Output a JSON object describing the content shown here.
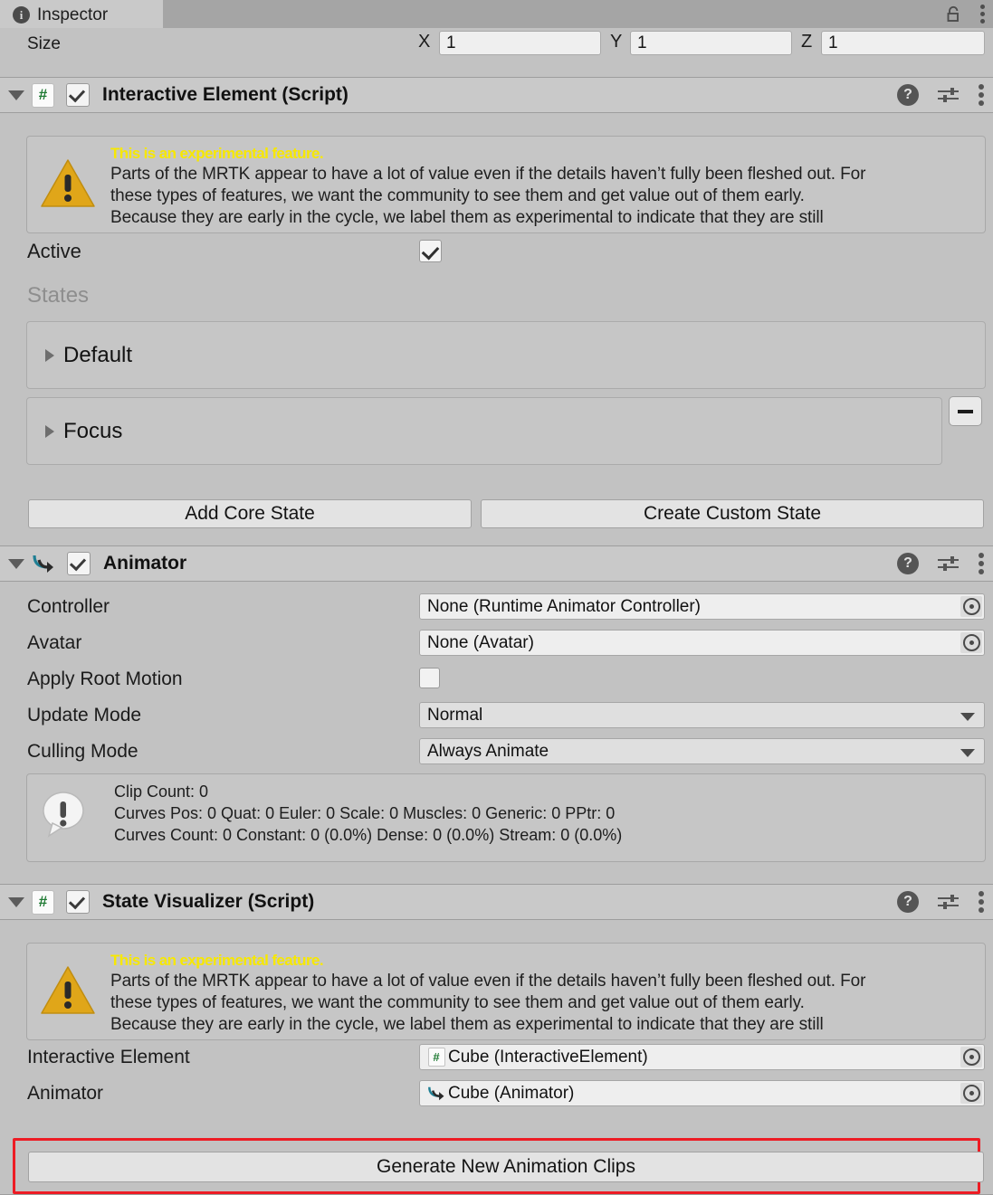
{
  "window": {
    "tab_label": "Inspector",
    "info_icon": "info-icon",
    "lock_icon": "lock-icon",
    "kebab_icon": "kebab-menu-icon"
  },
  "size_row": {
    "label": "Size",
    "x_axis": "X",
    "x_value": "1",
    "y_axis": "Y",
    "y_value": "1",
    "z_axis": "Z",
    "z_value": "1"
  },
  "components": [
    {
      "title": "Interactive Element (Script)",
      "icon": "script-icon",
      "icon_glyph": "#",
      "enabled": true,
      "help_icon": "help-icon",
      "preset_icon": "preset-icon",
      "kebab_icon": "kebab-menu-icon"
    },
    {
      "title": "Animator",
      "icon": "animator-icon",
      "enabled": true,
      "help_icon": "help-icon",
      "preset_icon": "preset-icon",
      "kebab_icon": "kebab-menu-icon"
    },
    {
      "title": "State Visualizer (Script)",
      "icon": "script-icon",
      "icon_glyph": "#",
      "enabled": true,
      "help_icon": "help-icon",
      "preset_icon": "preset-icon",
      "kebab_icon": "kebab-menu-icon"
    }
  ],
  "experimental_warning": {
    "icon": "warning-triangle-icon",
    "title": "This is an experimental feature.",
    "line1": "Parts of the MRTK appear to have a lot of value even if the details haven’t fully been fleshed out. For",
    "line2": "these types of features, we want the community to see them and get value out of them early.",
    "line3": "Because they are early in the cycle, we label them as experimental to indicate that they are still"
  },
  "interactive_element": {
    "active_label": "Active",
    "active_checked": true,
    "states_label": "States",
    "states": [
      {
        "name": "Default",
        "removable": false
      },
      {
        "name": "Focus",
        "removable": true,
        "remove_label": "–"
      }
    ],
    "add_core_state_button": "Add Core State",
    "create_custom_state_button": "Create Custom State"
  },
  "animator": {
    "fields": [
      {
        "label": "Controller",
        "value": "None (Runtime Animator Controller)",
        "type": "object"
      },
      {
        "label": "Avatar",
        "value": "None (Avatar)",
        "type": "object"
      },
      {
        "label": "Apply Root Motion",
        "value": "",
        "type": "checkbox",
        "checked": false
      },
      {
        "label": "Update Mode",
        "value": "Normal",
        "type": "dropdown"
      },
      {
        "label": "Culling Mode",
        "value": "Always Animate",
        "type": "dropdown"
      }
    ],
    "info": {
      "icon": "info-bubble-icon",
      "line1": "Clip Count: 0",
      "line2": "Curves Pos: 0 Quat: 0 Euler: 0 Scale: 0 Muscles: 0 Generic: 0 PPtr: 0",
      "line3": "Curves Count: 0 Constant: 0 (0.0%) Dense: 0 (0.0%) Stream: 0 (0.0%)"
    }
  },
  "state_visualizer": {
    "interactive_element_label": "Interactive Element",
    "interactive_element_value": "Cube (InteractiveElement)",
    "interactive_element_icon": "script-icon",
    "interactive_element_icon_glyph": "#",
    "animator_label": "Animator",
    "animator_value": "Cube (Animator)",
    "animator_icon": "animator-icon",
    "generate_button": "Generate New Animation Clips"
  },
  "colors": {
    "background": "#c2c2c2",
    "header": "#c9c9c9",
    "tabbar": "#a5a5a5",
    "warning_yellow": "#f7e800",
    "warning_triangle": "#e0a619",
    "script_green": "#1f7a33",
    "animator_teal": "#1f7f94",
    "highlight_red": "#ed1c24"
  }
}
